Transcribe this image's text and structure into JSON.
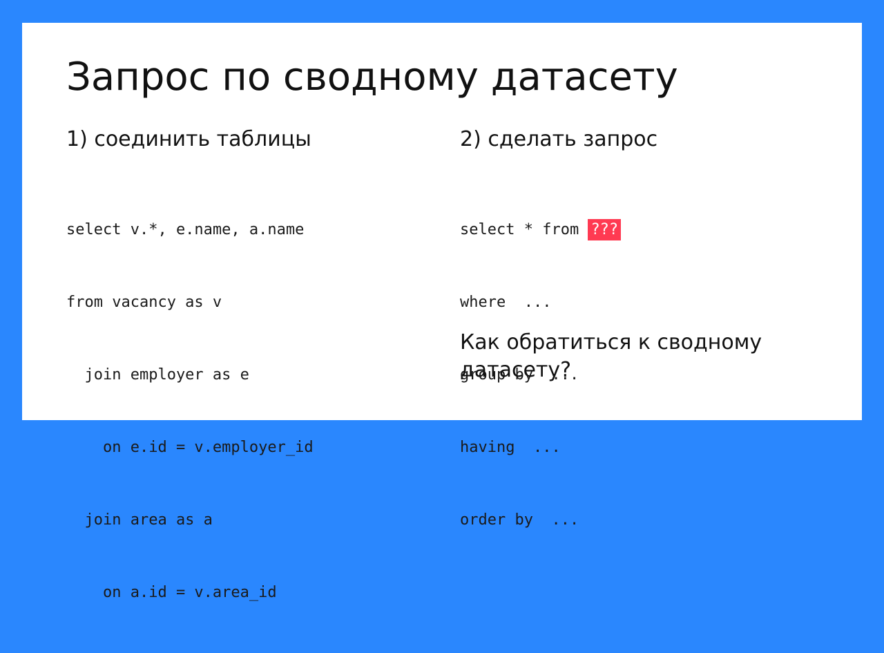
{
  "slide": {
    "title": "Запрос по сводному датасету",
    "colors": {
      "frame": "#2a87fe",
      "card": "#ffffff",
      "highlight": "#ff3a52"
    }
  },
  "left": {
    "heading": "1) соединить таблицы",
    "code": [
      "select v.*, e.name, a.name",
      "from vacancy as v",
      "  join employer as e",
      "    on e.id = v.employer_id",
      "  join area as a",
      "    on a.id = v.area_id"
    ]
  },
  "right": {
    "heading": "2) сделать запрос",
    "code_first_prefix": "select * from ",
    "code_highlight": "???",
    "code": [
      "where  ...",
      "group by  ...",
      "having  ...",
      "order by  ..."
    ],
    "question": "Как обратиться к сводному датасету?"
  }
}
